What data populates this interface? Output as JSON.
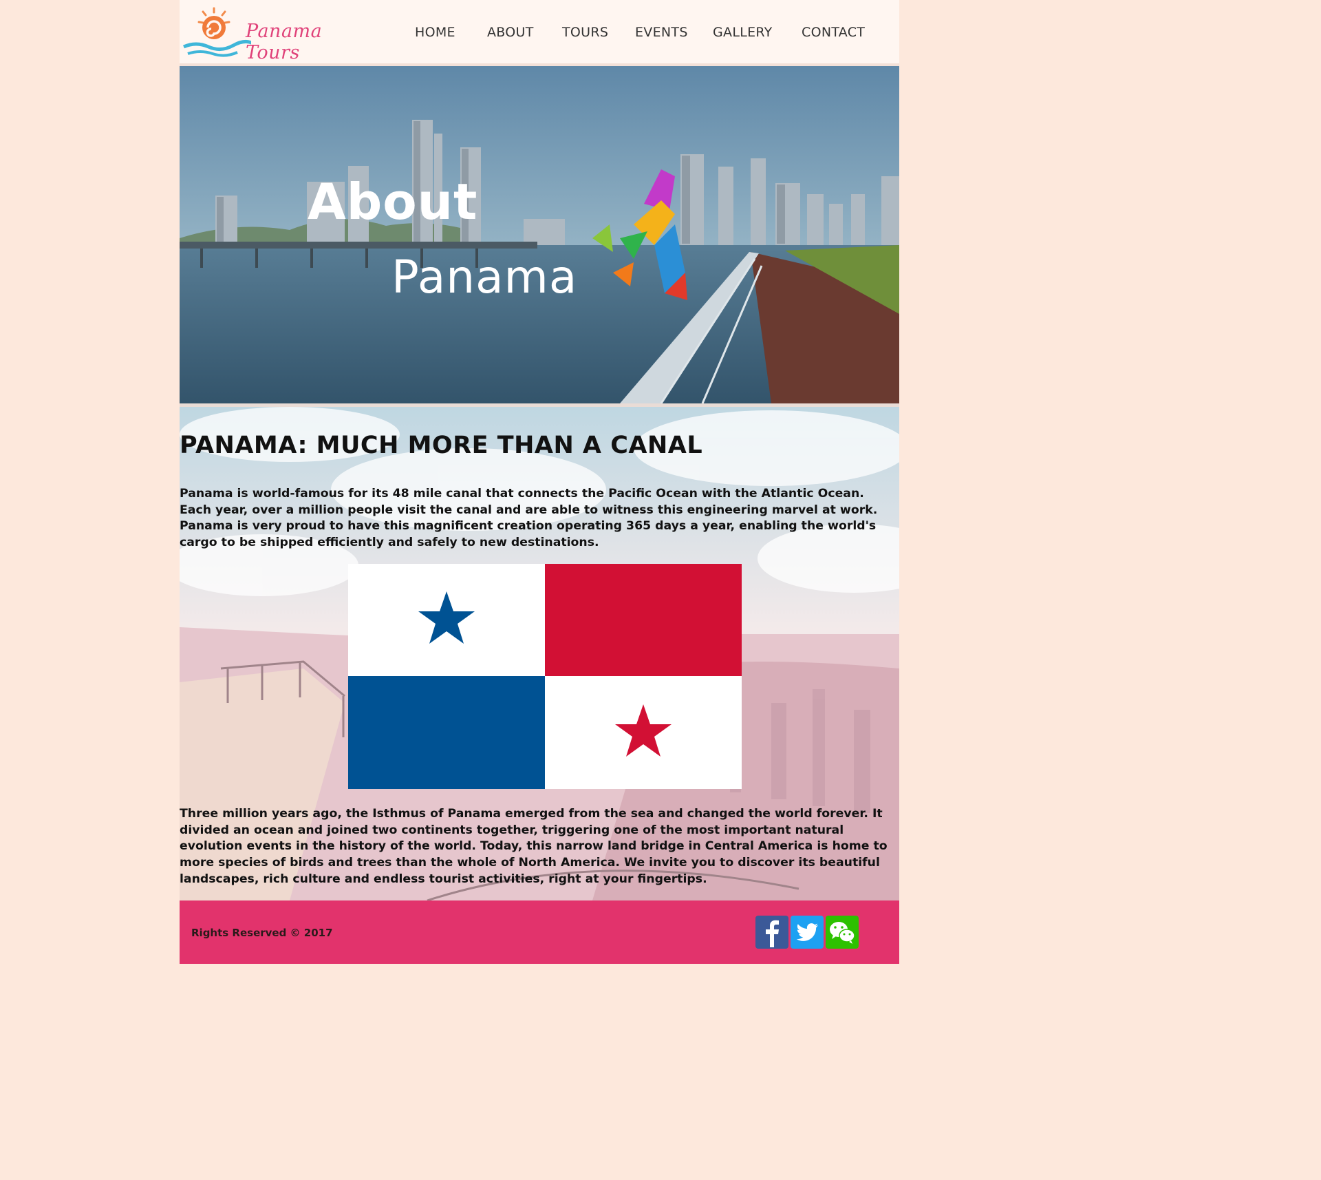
{
  "header": {
    "logo_text": "Panama Tours",
    "nav": [
      {
        "label": "HOME"
      },
      {
        "label": "ABOUT"
      },
      {
        "label": "TOURS"
      },
      {
        "label": "EVENTS"
      },
      {
        "label": "GALLERY"
      },
      {
        "label": "CONTACT"
      }
    ]
  },
  "hero": {
    "title_line1": "About",
    "title_line2": "Panama"
  },
  "main": {
    "heading": "PANAMA: MUCH MORE THAN A CANAL",
    "paragraph1": "Panama is world-famous for its 48 mile canal that connects the Pacific Ocean with the Atlantic Ocean. Each year, over a million people visit the canal and are able to witness this engineering marvel at work. Panama is very proud to have this magnificent creation operating 365 days a year, enabling the world's cargo to be shipped efficiently and safely to new destinations.",
    "paragraph2": "Three million years ago, the Isthmus of Panama emerged from the sea and changed the world forever. It divided an ocean and joined two continents together, triggering one of the most important natural evolution events in the history of the world. Today, this narrow land bridge in Central America is home to more species of birds and trees than the whole of North America. We invite you to discover its beautiful landscapes, rich culture and endless tourist activities, right at your fingertips."
  },
  "footer": {
    "rights": "Rights Reserved © 2017",
    "social": [
      {
        "icon": "facebook-icon",
        "color": "#3b5998"
      },
      {
        "icon": "twitter-icon",
        "color": "#1da1f2"
      },
      {
        "icon": "wechat-icon",
        "color": "#2dc100"
      }
    ]
  },
  "colors": {
    "page_bg": "#fde8dc",
    "accent": "#e2336c",
    "flag_red": "#d21034",
    "flag_blue": "#005293"
  }
}
